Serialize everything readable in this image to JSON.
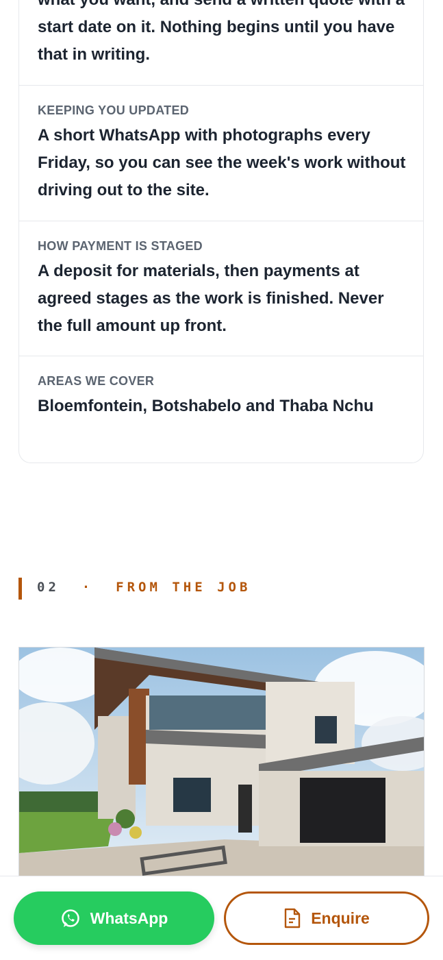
{
  "info_card": {
    "first_row_text": "what you want, and send a written quote with a start date on it. Nothing begins until you have that in writing.",
    "rows": [
      {
        "label": "KEEPING YOU UPDATED",
        "text": "A short WhatsApp with photographs every Friday, so you can see the week's work without driving out to the site."
      },
      {
        "label": "HOW PAYMENT IS STAGED",
        "text": "A deposit for materials, then payments at agreed stages as the work is finished. Never the full amount up front."
      },
      {
        "label": "AREAS WE COVER",
        "text": "Bloemfontein, Botshabelo and Thaba Nchu"
      }
    ]
  },
  "section": {
    "number": "02",
    "separator": "·",
    "title": "FROM THE JOB"
  },
  "photo": {
    "icon": "modern-house-photo"
  },
  "actions": {
    "whatsapp_label": "WhatsApp",
    "enquire_label": "Enquire"
  },
  "colors": {
    "accent": "#b4560b",
    "whatsapp_green": "#26cc5f",
    "text": "#1c2430",
    "label": "#5b6470"
  }
}
